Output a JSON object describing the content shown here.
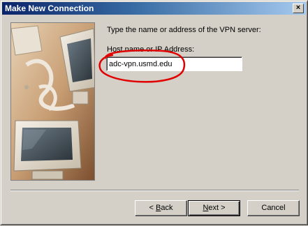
{
  "window": {
    "title": "Make New Connection",
    "close_glyph": "×",
    "icon_close": "close-icon"
  },
  "side_image": {
    "icon": "computer-monitors-illustration"
  },
  "content": {
    "prompt": "Type the name or address of the VPN server:",
    "host_label": "Host name or IP Address:",
    "host_value": "adc-vpn.usmd.edu",
    "annotation_color": "#e00000"
  },
  "buttons": {
    "back": {
      "prefix": "< ",
      "mnemonic": "B",
      "rest": "ack"
    },
    "next": {
      "mnemonic": "N",
      "rest": "ext >"
    },
    "cancel": "Cancel"
  },
  "colors": {
    "dialog_bg": "#d4d0c8",
    "titlebar_start": "#0a246a",
    "titlebar_end": "#a6caf0"
  }
}
